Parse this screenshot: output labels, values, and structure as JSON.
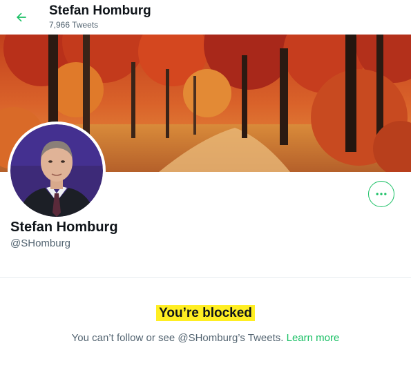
{
  "header": {
    "name": "Stefan Homburg",
    "tweet_count": "7,966 Tweets",
    "back_icon": "arrow-left-icon"
  },
  "profile": {
    "name": "Stefan Homburg",
    "handle": "@SHomburg",
    "more_icon": "more-horizontal-icon"
  },
  "blocked": {
    "title": "You’re blocked",
    "message": "You can’t follow or see @SHomburg’s Tweets.",
    "link": "Learn more"
  },
  "colors": {
    "accent": "#17bf63",
    "highlight": "#ffee22",
    "secondary_text": "#536471"
  }
}
